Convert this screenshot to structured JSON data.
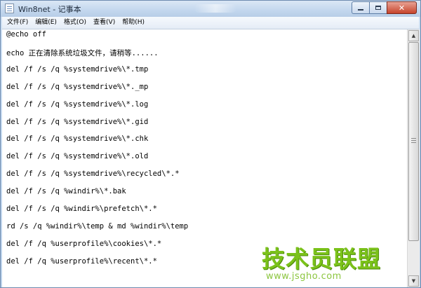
{
  "window": {
    "title": "Win8net - 记事本"
  },
  "menu": [
    "文件(F)",
    "编辑(E)",
    "格式(O)",
    "查看(V)",
    "帮助(H)"
  ],
  "lines": [
    "@echo off",
    "echo 正在清除系统垃圾文件，请稍等......",
    "del /f /s /q %systemdrive%\\*.tmp",
    "del /f /s /q %systemdrive%\\*._mp",
    "del /f /s /q %systemdrive%\\*.log",
    "del /f /s /q %systemdrive%\\*.gid",
    "del /f /s /q %systemdrive%\\*.chk",
    "del /f /s /q %systemdrive%\\*.old",
    "del /f /s /q %systemdrive%\\recycled\\*.*",
    "del /f /s /q %windir%\\*.bak",
    "del /f /s /q %windir%\\prefetch\\*.*",
    "rd /s /q %windir%\\temp & md %windir%\\temp",
    "del /f /q %userprofile%\\cookies\\*.*",
    "del /f /q %userprofile%\\recent\\*.*"
  ],
  "watermark": {
    "title": "技术员联盟",
    "url": "www.jsgho.com"
  },
  "icons": {
    "app": "notepad-icon",
    "minimize": "minimize-icon",
    "maximize": "maximize-icon",
    "close": "close-icon"
  },
  "colors": {
    "close_button": "#c7432b",
    "watermark": "#7bc21a"
  }
}
